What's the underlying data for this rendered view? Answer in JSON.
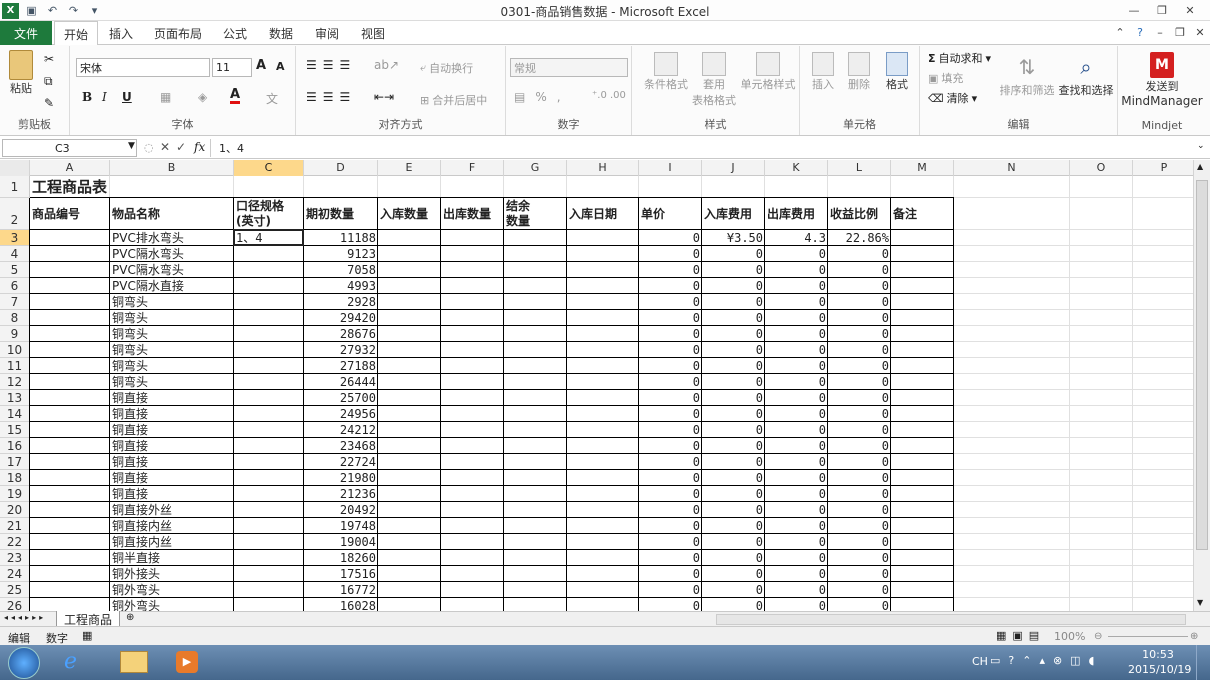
{
  "window": {
    "title": "0301-商品销售数据 - Microsoft Excel"
  },
  "tabs": [
    "文件",
    "开始",
    "插入",
    "页面布局",
    "公式",
    "数据",
    "审阅",
    "视图"
  ],
  "ribbon": {
    "clipboard": {
      "label": "剪贴板",
      "paste": "粘贴"
    },
    "font": {
      "label": "字体",
      "name": "宋体",
      "size": "11"
    },
    "alignment": {
      "label": "对齐方式",
      "wrap": "自动换行",
      "merge": "合并后居中"
    },
    "number": {
      "label": "数字",
      "format": "常规"
    },
    "styles": {
      "label": "样式",
      "cond": "条件格式",
      "table1": "套用",
      "table2": "表格格式",
      "cell": "单元格样式"
    },
    "cells": {
      "label": "单元格",
      "insert": "插入",
      "delete": "删除",
      "format": "格式"
    },
    "editing": {
      "label": "编辑",
      "autosum": "自动求和",
      "fill": "填充",
      "clear": "清除",
      "sort": "排序和筛选",
      "find": "查找和选择"
    },
    "mindjet": {
      "label": "Mindjet",
      "send1": "发送到",
      "send2": "MindManager"
    }
  },
  "formula_bar": {
    "name_box": "C3",
    "fx": "fx",
    "content": "1、4"
  },
  "columns": [
    "A",
    "B",
    "C",
    "D",
    "E",
    "F",
    "G",
    "H",
    "I",
    "J",
    "K",
    "L",
    "M",
    "N",
    "O",
    "P"
  ],
  "rows": [
    "1",
    "2",
    "3",
    "4",
    "5",
    "6",
    "7",
    "8",
    "9",
    "10",
    "11",
    "12",
    "13",
    "14",
    "15",
    "16",
    "17",
    "18",
    "19",
    "20",
    "21",
    "22",
    "23",
    "24",
    "25",
    "26"
  ],
  "sheet": {
    "title": "工程商品表",
    "headers": {
      "A": "商品编号",
      "B": "物品名称",
      "C1": "口径规格",
      "C2": "(英寸)",
      "D": "期初数量",
      "E": "入库数量",
      "F": "出库数量",
      "G1": "结余",
      "G2": "数量",
      "H": "入库日期",
      "I": "单价",
      "J": "入库费用",
      "K": "出库费用",
      "L": "收益比例",
      "M": "备注"
    },
    "data": [
      {
        "B": "PVC排水弯头",
        "C": "1、4",
        "D": "11188",
        "I": "0",
        "J": "¥3.50",
        "K": "4.3",
        "L": "22.86%"
      },
      {
        "B": "PVC隔水弯头",
        "D": "9123",
        "I": "0",
        "J": "0",
        "K": "0",
        "L": "0"
      },
      {
        "B": "PVC隔水弯头",
        "D": "7058",
        "I": "0",
        "J": "0",
        "K": "0",
        "L": "0"
      },
      {
        "B": "PVC隔水直接",
        "D": "4993",
        "I": "0",
        "J": "0",
        "K": "0",
        "L": "0"
      },
      {
        "B": "铜弯头",
        "D": "2928",
        "I": "0",
        "J": "0",
        "K": "0",
        "L": "0"
      },
      {
        "B": "铜弯头",
        "D": "29420",
        "I": "0",
        "J": "0",
        "K": "0",
        "L": "0"
      },
      {
        "B": "铜弯头",
        "D": "28676",
        "I": "0",
        "J": "0",
        "K": "0",
        "L": "0"
      },
      {
        "B": "铜弯头",
        "D": "27932",
        "I": "0",
        "J": "0",
        "K": "0",
        "L": "0"
      },
      {
        "B": "铜弯头",
        "D": "27188",
        "I": "0",
        "J": "0",
        "K": "0",
        "L": "0"
      },
      {
        "B": "铜弯头",
        "D": "26444",
        "I": "0",
        "J": "0",
        "K": "0",
        "L": "0"
      },
      {
        "B": "铜直接",
        "D": "25700",
        "I": "0",
        "J": "0",
        "K": "0",
        "L": "0"
      },
      {
        "B": "铜直接",
        "D": "24956",
        "I": "0",
        "J": "0",
        "K": "0",
        "L": "0"
      },
      {
        "B": "铜直接",
        "D": "24212",
        "I": "0",
        "J": "0",
        "K": "0",
        "L": "0"
      },
      {
        "B": "铜直接",
        "D": "23468",
        "I": "0",
        "J": "0",
        "K": "0",
        "L": "0"
      },
      {
        "B": "铜直接",
        "D": "22724",
        "I": "0",
        "J": "0",
        "K": "0",
        "L": "0"
      },
      {
        "B": "铜直接",
        "D": "21980",
        "I": "0",
        "J": "0",
        "K": "0",
        "L": "0"
      },
      {
        "B": "铜直接",
        "D": "21236",
        "I": "0",
        "J": "0",
        "K": "0",
        "L": "0"
      },
      {
        "B": "铜直接外丝",
        "D": "20492",
        "I": "0",
        "J": "0",
        "K": "0",
        "L": "0"
      },
      {
        "B": "铜直接内丝",
        "D": "19748",
        "I": "0",
        "J": "0",
        "K": "0",
        "L": "0"
      },
      {
        "B": "铜直接内丝",
        "D": "19004",
        "I": "0",
        "J": "0",
        "K": "0",
        "L": "0"
      },
      {
        "B": "铜半直接",
        "D": "18260",
        "I": "0",
        "J": "0",
        "K": "0",
        "L": "0"
      },
      {
        "B": "铜外接头",
        "D": "17516",
        "I": "0",
        "J": "0",
        "K": "0",
        "L": "0"
      },
      {
        "B": "铜外弯头",
        "D": "16772",
        "I": "0",
        "J": "0",
        "K": "0",
        "L": "0"
      },
      {
        "B": "铜外弯头",
        "D": "16028",
        "I": "0",
        "J": "0",
        "K": "0",
        "L": "0"
      }
    ]
  },
  "sheet_tab": "工程商品",
  "status": {
    "mode": "编辑",
    "num": "数字",
    "zoom": "100%"
  },
  "taskbar": {
    "ime": "CH",
    "time": "10:53",
    "date": "2015/10/19"
  },
  "colors": {
    "accent": "#1e7a3c",
    "active_header": "#fdd88b"
  }
}
